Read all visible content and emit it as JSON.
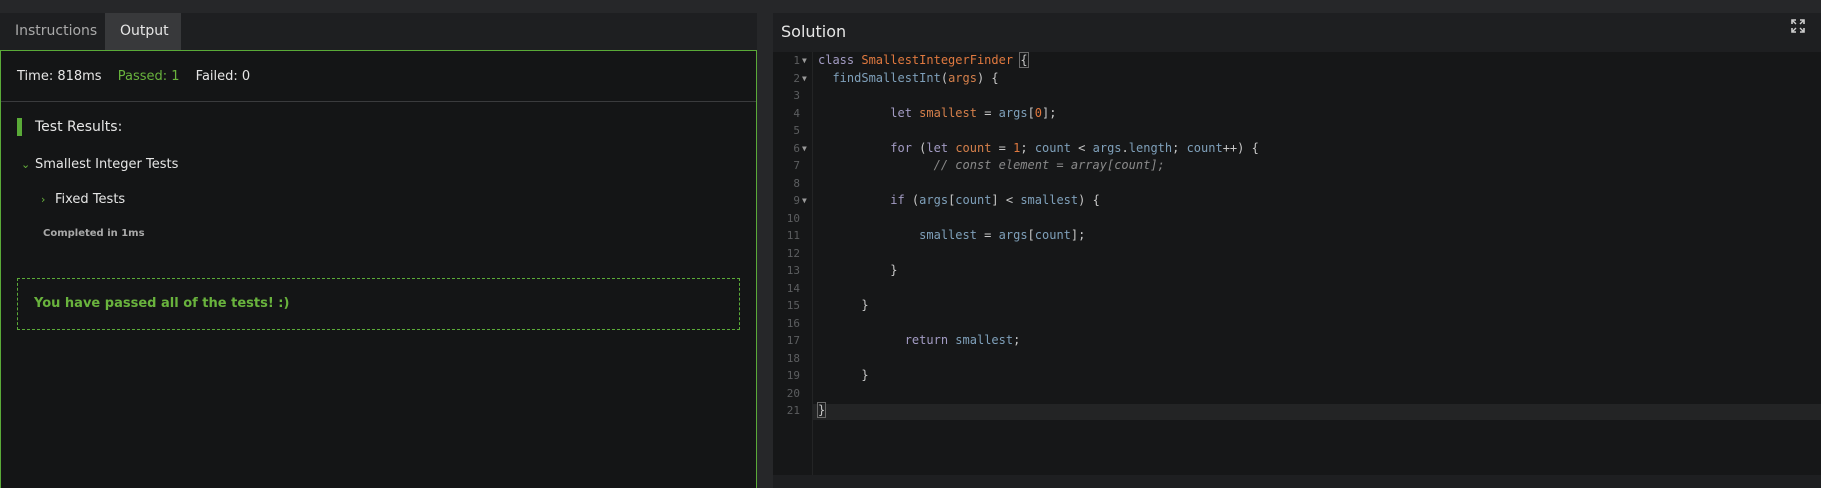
{
  "tabs": [
    {
      "label": "Instructions"
    },
    {
      "label": "Output"
    }
  ],
  "status": {
    "time": "Time: 818ms",
    "passed": "Passed: 1",
    "failed": "Failed: 0"
  },
  "results": {
    "title": "Test Results:",
    "group": "Smallest Integer Tests",
    "subgroup": "Fixed Tests",
    "completed": "Completed in 1ms",
    "pass_message": "You have passed all of the tests! :)"
  },
  "solution": {
    "title": "Solution",
    "active_line": 21,
    "line_numbers": [
      "1",
      "2",
      "3",
      "4",
      "5",
      "6",
      "7",
      "8",
      "9",
      "10",
      "11",
      "12",
      "13",
      "14",
      "15",
      "16",
      "17",
      "18",
      "19",
      "20",
      "21"
    ],
    "code": {
      "l1_kw": "class",
      "l1_cls": "SmallestIntegerFinder",
      "l1_brace": "{",
      "l2_fn": "findSmallestInt",
      "l2_open": "(",
      "l2_arg": "args",
      "l2_close": ") {",
      "l4_kw": "let",
      "l4_var": "smallest",
      "l4_eq": " = ",
      "l4_id": "args",
      "l4_b1": "[",
      "l4_num": "0",
      "l4_b2": "];",
      "l6_kw1": "for",
      "l6_p1": " (",
      "l6_kw2": "let",
      "l6_var": "count",
      "l6_eq": " = ",
      "l6_num": "1",
      "l6_semi1": "; ",
      "l6_id1": "count",
      "l6_lt": " < ",
      "l6_id2": "args",
      "l6_dot": ".",
      "l6_id3": "length",
      "l6_semi2": "; ",
      "l6_id4": "count",
      "l6_end": "++) {",
      "l7_comment": "// const element = array[count];",
      "l9_kw": "if",
      "l9_p": " (",
      "l9_id1": "args",
      "l9_b1": "[",
      "l9_id2": "count",
      "l9_b2": "] < ",
      "l9_id3": "smallest",
      "l9_end": ") {",
      "l11_id1": "smallest",
      "l11_eq": " = ",
      "l11_id2": "args",
      "l11_b1": "[",
      "l11_id3": "count",
      "l11_end": "];",
      "l13": "}",
      "l15": "}",
      "l17_kw": "return",
      "l17_id": "smallest",
      "l17_end": ";",
      "l19": "}",
      "l21": "}"
    }
  }
}
